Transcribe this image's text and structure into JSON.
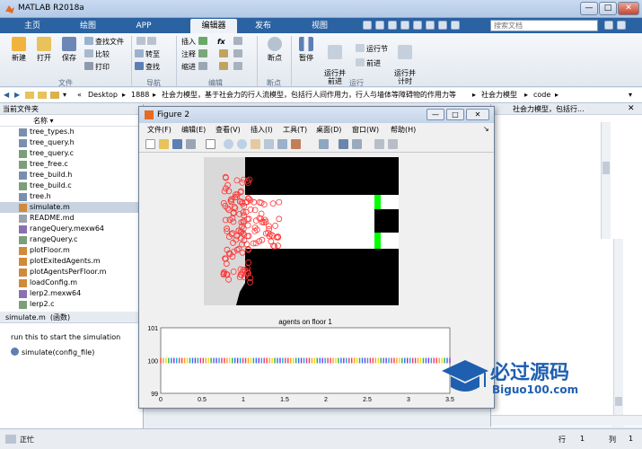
{
  "window": {
    "title": "MATLAB R2018a",
    "min": "—",
    "max": "□",
    "close": "✕"
  },
  "tabs": [
    {
      "label": "主页"
    },
    {
      "label": "绘图"
    },
    {
      "label": "APP"
    },
    {
      "label": "编辑器"
    },
    {
      "label": "发布"
    },
    {
      "label": "视图"
    }
  ],
  "search": {
    "placeholder": "搜索文档"
  },
  "ribbon": {
    "new": "新建",
    "open": "打开",
    "save": "保存",
    "find_files": "查找文件",
    "compare": "比较",
    "print": "打印",
    "file_group": "文件",
    "goto": "转至",
    "find": "查找",
    "nav_group": "导航",
    "insert": "插入",
    "fx": "fx",
    "comment": "注释",
    "indent": "缩进",
    "edit_group": "编辑",
    "breakpoints": "断点",
    "bp_group": "断点",
    "pause": "暂停",
    "run_advance": "运行并\n前进",
    "run_section": "运行节",
    "advance": "前进",
    "run_time": "运行并\n计时",
    "run_group": "运行"
  },
  "addressbar": {
    "sep": "«",
    "crumbs": [
      "Desktop",
      "1888",
      "社会力模型，基于社会力的行人流模型，包括行人间作用力，行人与墙体等障碍物的作用力等",
      "社会力模型",
      "code"
    ]
  },
  "file_browser": {
    "header": "当前文件夹",
    "column": "名称",
    "files": [
      {
        "name": "tree_types.h",
        "type": "h"
      },
      {
        "name": "tree_query.h",
        "type": "h"
      },
      {
        "name": "tree_query.c",
        "type": "c"
      },
      {
        "name": "tree_free.c",
        "type": "c"
      },
      {
        "name": "tree_build.h",
        "type": "h"
      },
      {
        "name": "tree_build.c",
        "type": "c"
      },
      {
        "name": "tree.h",
        "type": "h"
      },
      {
        "name": "simulate.m",
        "type": "m",
        "selected": true
      },
      {
        "name": "README.md",
        "type": "md"
      },
      {
        "name": "rangeQuery.mexw64",
        "type": "mex"
      },
      {
        "name": "rangeQuery.c",
        "type": "c"
      },
      {
        "name": "plotFloor.m",
        "type": "m"
      },
      {
        "name": "plotExitedAgents.m",
        "type": "m"
      },
      {
        "name": "plotAgentsPerFloor.m",
        "type": "m"
      },
      {
        "name": "loadConfig.m",
        "type": "m"
      },
      {
        "name": "lerp2.mexw64",
        "type": "mex"
      },
      {
        "name": "lerp2.c",
        "type": "c"
      }
    ]
  },
  "detail": {
    "file": "simulate.m",
    "kind": "(函数)",
    "description": "run this to start the simulation",
    "signature": "simulate(config_file)"
  },
  "right_pane": {
    "snippet": "社会力模型，包括行..."
  },
  "statusbar": {
    "status": "正忙",
    "row_label": "行",
    "row_value": "1",
    "col_label": "列",
    "col_value": "1"
  },
  "figure": {
    "title": "Figure 2",
    "menus": [
      "文件(F)",
      "编辑(E)",
      "查看(V)",
      "插入(I)",
      "工具(T)",
      "桌面(D)",
      "窗口(W)",
      "帮助(H)"
    ]
  },
  "chart_data": [
    {
      "type": "scatter",
      "title": "",
      "description_label": "",
      "xlabel": "",
      "ylabel": ""
    },
    {
      "type": "scatter",
      "title": "agents on floor 1",
      "xlabel": "",
      "ylabel": "",
      "xlim": [
        0,
        3.5
      ],
      "ylim": [
        99,
        101
      ],
      "xticks": [
        "0",
        "0.5",
        "1",
        "1.5",
        "2",
        "2.5",
        "3",
        "3.5"
      ],
      "yticks": [
        "101",
        "100",
        "99"
      ],
      "series": [
        {
          "value": 100
        }
      ]
    }
  ],
  "watermark": {
    "text": "必过源码",
    "url": "Biguo100.com"
  },
  "colors": {
    "accent": "#2a62a2",
    "agent": "#ff3333",
    "exit": "#00ff00"
  },
  "misc": {
    "fx_label": "fx"
  }
}
